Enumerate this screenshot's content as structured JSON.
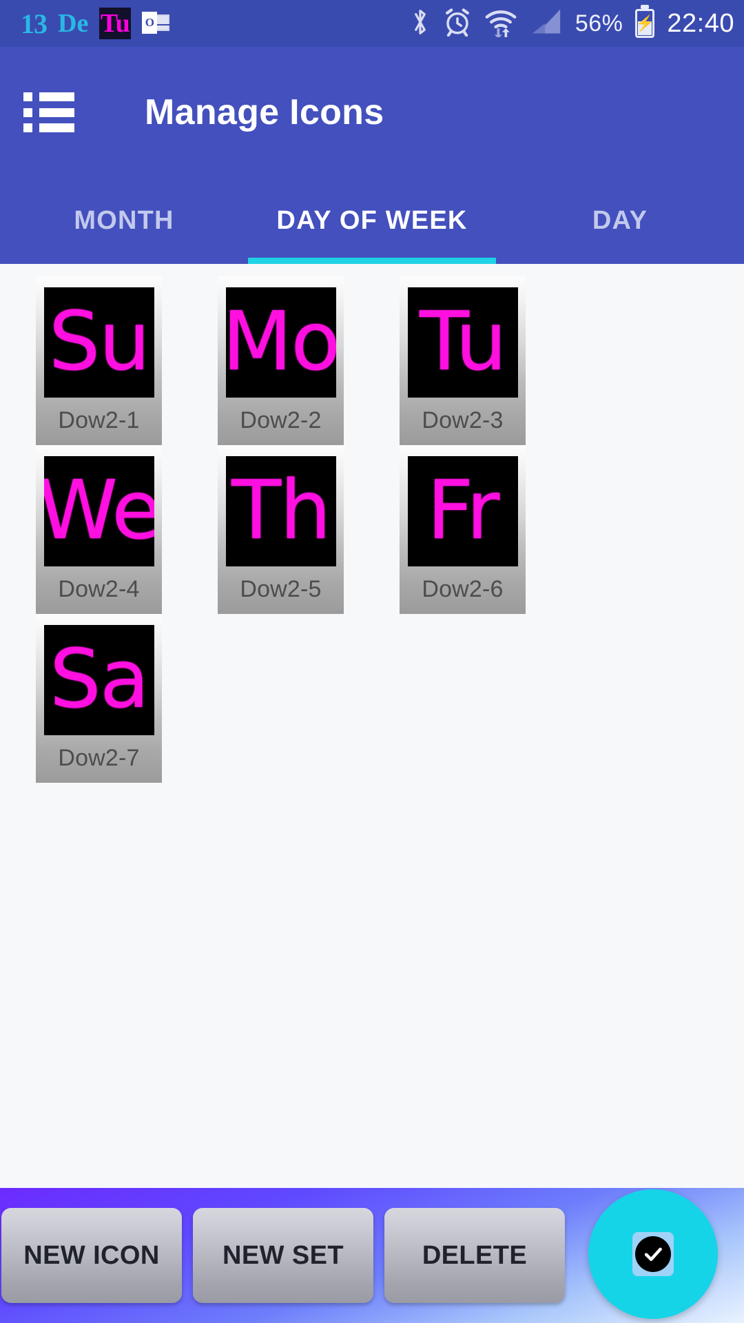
{
  "status_bar": {
    "date_day": "13",
    "date_month": "De",
    "weekday_icon_text": "Tu",
    "outlook_icon_letter": "O",
    "icons": [
      "bluetooth-icon",
      "alarm-icon",
      "wifi-icon",
      "signal-icon"
    ],
    "battery_percent": "56%",
    "time": "22:40",
    "background_color": "#3a4bb0"
  },
  "app_bar": {
    "menu_icon": "list-menu-icon",
    "title": "Manage Icons",
    "background_color": "#4350bd"
  },
  "tabs": {
    "indicator_color": "#1fd2e6",
    "items": [
      {
        "label": "MONTH",
        "active": false
      },
      {
        "label": "DAY OF WEEK",
        "active": true
      },
      {
        "label": "DAY",
        "active": false
      }
    ]
  },
  "icon_grid": {
    "tiles": [
      {
        "glyph": "Su",
        "label": "Dow2-1"
      },
      {
        "glyph": "Mo",
        "label": "Dow2-2"
      },
      {
        "glyph": "Tu",
        "label": "Dow2-3"
      },
      {
        "glyph": "We",
        "label": "Dow2-4"
      },
      {
        "glyph": "Th",
        "label": "Dow2-5"
      },
      {
        "glyph": "Fr",
        "label": "Dow2-6"
      },
      {
        "glyph": "Sa",
        "label": "Dow2-7"
      }
    ],
    "glyph_color": "#ff10e0",
    "thumb_background": "#000000"
  },
  "bottom_bar": {
    "buttons": [
      {
        "label": "NEW ICON"
      },
      {
        "label": "NEW SET"
      },
      {
        "label": "DELETE"
      }
    ],
    "fab": {
      "icon": "check-circle-icon",
      "color": "#16d4e8"
    }
  }
}
